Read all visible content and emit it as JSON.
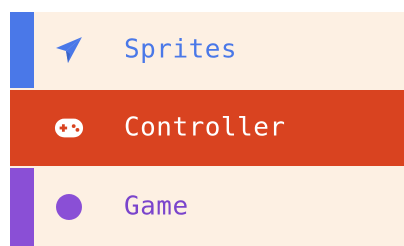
{
  "menu": {
    "items": [
      {
        "label": "Sprites",
        "icon": "paper-plane-icon",
        "accent": "#4a78e8",
        "text_color": "#4a78e8",
        "active": false
      },
      {
        "label": "Controller",
        "icon": "gamepad-icon",
        "accent": "#d94320",
        "text_color": "#ffffff",
        "active": true
      },
      {
        "label": "Game",
        "icon": "circle-icon",
        "accent": "#8a4fd6",
        "text_color": "#7a44cc",
        "active": false
      }
    ]
  },
  "colors": {
    "menu_background": "#fdf0e3",
    "active_background": "#d94320"
  }
}
